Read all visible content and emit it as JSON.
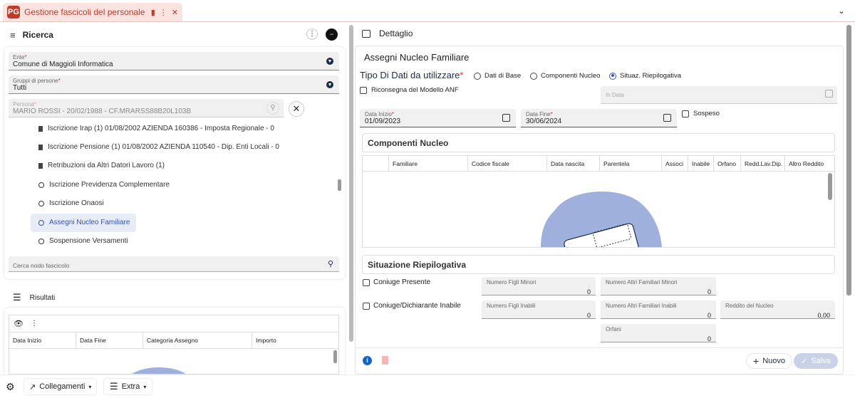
{
  "tab": {
    "logo": "PG",
    "title": "Gestione fascicoli del personale"
  },
  "ricerca": {
    "title": "Ricerca",
    "ente": {
      "label": "Ente",
      "value": "Comune di Maggioli Informatica"
    },
    "gruppi": {
      "label": "Gruppi di persone",
      "value": "Tutti"
    },
    "persona": {
      "label": "Persona",
      "value": "MARIO ROSSI - 20/02/1988 - CF.MRARSS88B20L103B"
    },
    "tree": [
      {
        "label": "Iscrizione Irap (1) 01/08/2002 AZIENDA 160386 - Imposta Regionale - 0",
        "icon": "doc-icon"
      },
      {
        "label": "Iscrizione Pensione (1) 01/08/2002 AZIENDA 110540 - Dip. Enti Locali - 0",
        "icon": "doc-icon"
      },
      {
        "label": "Retribuzioni da Altri Datori Lavoro (1)",
        "icon": "doc-icon"
      },
      {
        "label": "Iscrizione Previdenza Complementare",
        "icon": "circle-icon"
      },
      {
        "label": "Iscrizione Onaosi",
        "icon": "circle-icon"
      },
      {
        "label": "Assegni Nucleo Familiare",
        "icon": "circle-icon"
      },
      {
        "label": "Sospensione Versamenti",
        "icon": "circle-icon"
      }
    ],
    "search_placeholder": "Cerca nodo fascicolo"
  },
  "risultati": {
    "title": "Risultati",
    "columns": [
      "Data Inizio",
      "Data Fine",
      "Categoria Assegno",
      "Importo"
    ]
  },
  "dettaglio": {
    "title": "Dettaglio",
    "section_title": "Assegni Nucleo Familiare",
    "tipo_label": "Tipo Di Dati da utilizzare",
    "radios": [
      "Dati di Base",
      "Componenti Nucleo",
      "Situaz. Riepilogativa"
    ],
    "riconsegna": "Riconsegna del Modello ANF",
    "in_data": "In Data",
    "data_inizio": {
      "label": "Data Inizio",
      "value": "01/09/2023"
    },
    "data_fine": {
      "label": "Data Fine",
      "value": "30/06/2024"
    },
    "sospeso": "Sospeso",
    "componenti": {
      "title": "Componenti Nucleo",
      "columns": [
        "Familiare",
        "Codice fiscale",
        "Data nascita",
        "Parentela",
        "Associ",
        "Inabile",
        "Orfano",
        "Redd.Lav.Dip.",
        "Altro Reddito"
      ]
    },
    "situazione": {
      "title": "Situazione Riepilogativa",
      "coniuge_presente": "Coniuge Presente",
      "coniuge_inabile": "Coniuge/Dichiarante Inabile",
      "fields": {
        "figli_minori": {
          "label": "Numero Figli Minori",
          "value": "0"
        },
        "altri_minori": {
          "label": "Numero Altri Familiari Minori",
          "value": "0"
        },
        "figli_inabili": {
          "label": "Numero Figli Inabili",
          "value": "0"
        },
        "altri_inabili": {
          "label": "Numero Altri Familiari Inabili",
          "value": "0"
        },
        "reddito": {
          "label": "Reddito del Nucleo",
          "value": "0,00"
        },
        "orfani": {
          "label": "Orfani",
          "value": "0"
        }
      }
    },
    "nuovo": "Nuovo",
    "salva": "Salva"
  },
  "footer": {
    "collegamenti": "Collegamenti",
    "extra": "Extra"
  },
  "colors": {
    "brand": "#c0392b",
    "accent": "#3b4fb0",
    "navy": "#1c2b45"
  }
}
